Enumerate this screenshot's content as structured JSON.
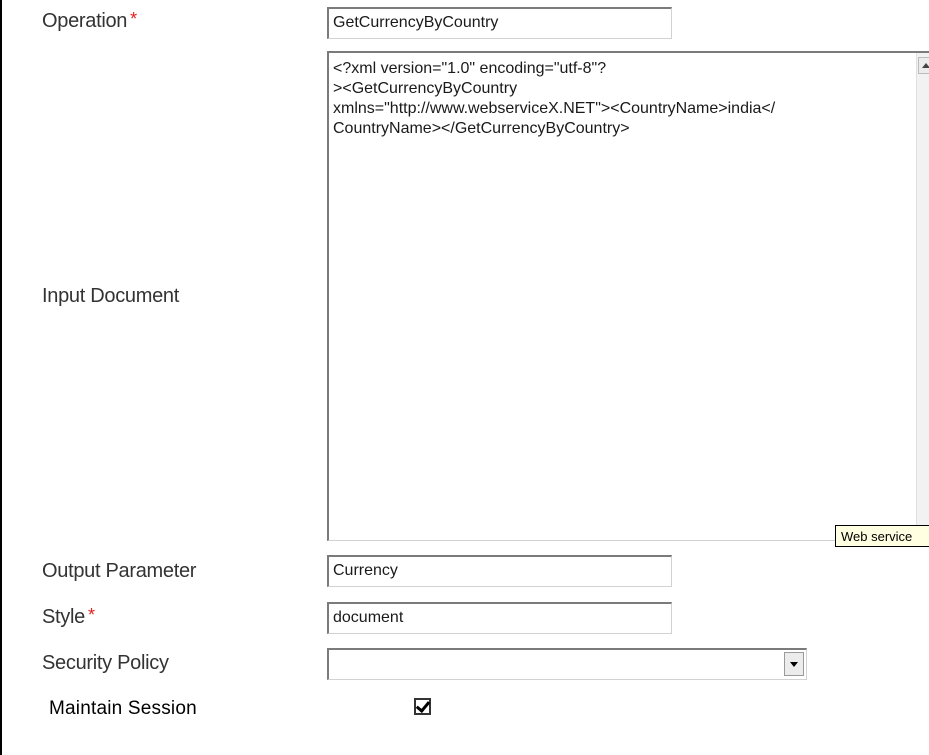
{
  "form": {
    "operation": {
      "label": "Operation",
      "required_mark": "*",
      "value": "GetCurrencyByCountry"
    },
    "input_document": {
      "label": "Input Document",
      "value": "<?xml version=\"1.0\" encoding=\"utf-8\"?\n><GetCurrencyByCountry\nxmlns=\"http://www.webserviceX.NET\"><CountryName>india</\nCountryName></GetCurrencyByCountry>",
      "tooltip": "Web service"
    },
    "output_parameter": {
      "label": "Output Parameter",
      "value": "Currency"
    },
    "style": {
      "label": "Style",
      "required_mark": "*",
      "value": "document"
    },
    "security_policy": {
      "label": "Security Policy",
      "selected": ""
    },
    "maintain_session": {
      "label": "Maintain Session",
      "checked": true
    }
  },
  "colors": {
    "required": "#e0201c",
    "label_text": "#333333",
    "tooltip_bg": "#ffffe1"
  },
  "icons": {
    "scroll_up": "scroll-up-arrow-icon",
    "dropdown": "chevron-down-icon",
    "check": "checkmark-icon"
  }
}
